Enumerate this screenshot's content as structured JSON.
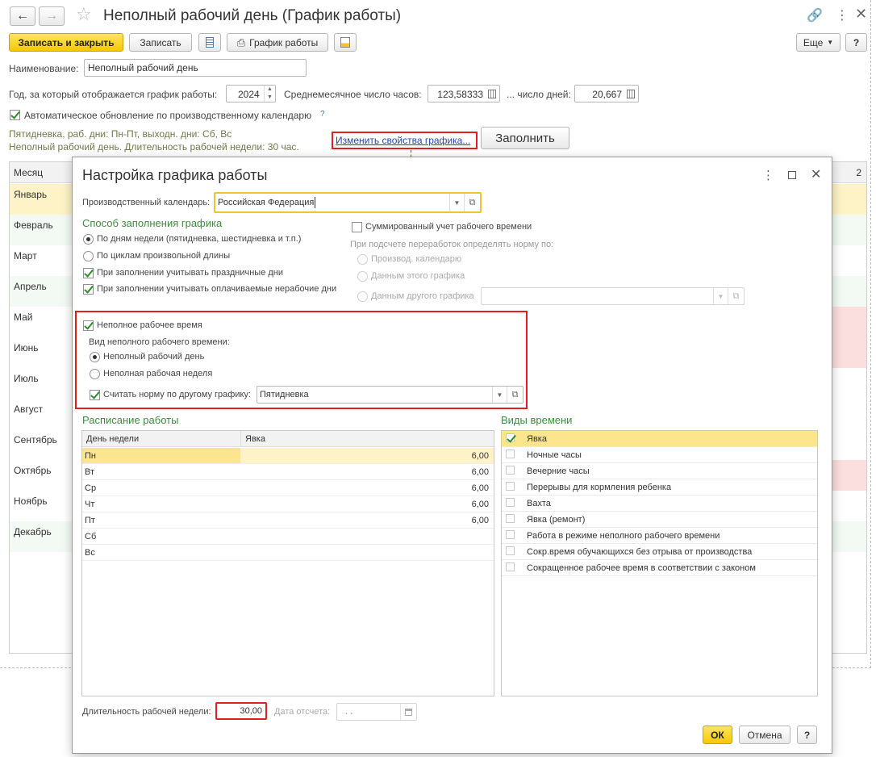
{
  "window": {
    "title": "Неполный рабочий день (График работы)"
  },
  "toolbar": {
    "save_close": "Записать и закрыть",
    "save": "Записать",
    "schedule_print": "График работы",
    "more": "Еще",
    "help": "?"
  },
  "form": {
    "name_label": "Наименование:",
    "name_value": "Неполный рабочий день",
    "year_label": "Год, за который отображается график работы:",
    "year_value": "2024",
    "avg_hours_label": "Среднемесячное число часов:",
    "avg_hours_value": "123,58333",
    "days_label": "... число дней:",
    "days_value": "20,667",
    "auto_update_label": "Автоматическое обновление по производственному календарю",
    "auto_update_help": "?",
    "info_line1": "Пятидневка, раб. дни: Пн-Пт, выходн. дни: Сб, Вс",
    "info_line2": "Неполный рабочий день. Длительность рабочей недели: 30 час.",
    "change_link": "Изменить свойства графика...",
    "fill_button": "Заполнить"
  },
  "calendar": {
    "month_header": "Месяц",
    "col_right": "2",
    "months": [
      "Январь",
      "Февраль",
      "Март",
      "Апрель",
      "Май",
      "Июнь",
      "Июль",
      "Август",
      "Сентябрь",
      "Октябрь",
      "Ноябрь",
      "Декабрь"
    ]
  },
  "dialog": {
    "title": "Настройка графика работы",
    "prod_calendar_label": "Производственный календарь:",
    "prod_calendar_value": "Российская Федерация",
    "fill_method_title": "Способ заполнения графика",
    "fill_by_weekdays": "По дням недели (пятидневка, шестидневка и т.п.)",
    "fill_by_cycles": "По циклам произвольной длины",
    "consider_holidays": "При заполнении учитывать праздничные дни",
    "consider_paid_nonwork": "При заполнении учитывать оплачиваемые нерабочие дни",
    "summed_accounting": "Суммированный учет рабочего времени",
    "overtime_norm_label": "При подсчете переработок определять норму по:",
    "norm_by_calendar": "Производ. календарю",
    "norm_by_this": "Данным этого графика",
    "norm_by_other": "Данным другого графика",
    "parttime_label": "Неполное рабочее время",
    "parttime_kind_label": "Вид неполного рабочего времени:",
    "parttime_day": "Неполный рабочий день",
    "parttime_week": "Неполная рабочая неделя",
    "norm_other_label": "Считать норму по другому графику:",
    "norm_other_value": "Пятидневка",
    "schedule_title": "Расписание работы",
    "schedule_col_day": "День недели",
    "schedule_col_attend": "Явка",
    "schedule_rows": [
      {
        "day": "Пн",
        "value": "6,00"
      },
      {
        "day": "Вт",
        "value": "6,00"
      },
      {
        "day": "Ср",
        "value": "6,00"
      },
      {
        "day": "Чт",
        "value": "6,00"
      },
      {
        "day": "Пт",
        "value": "6,00"
      },
      {
        "day": "Сб",
        "value": ""
      },
      {
        "day": "Вс",
        "value": ""
      }
    ],
    "time_types_title": "Виды времени",
    "time_types": [
      {
        "label": "Явка",
        "checked": true
      },
      {
        "label": "Ночные часы",
        "checked": false
      },
      {
        "label": "Вечерние часы",
        "checked": false
      },
      {
        "label": "Перерывы для кормления ребенка",
        "checked": false
      },
      {
        "label": "Вахта",
        "checked": false
      },
      {
        "label": "Явка (ремонт)",
        "checked": false
      },
      {
        "label": "Работа в режиме неполного рабочего времени",
        "checked": false
      },
      {
        "label": "Сокр.время обучающихся без отрыва от производства",
        "checked": false
      },
      {
        "label": "Сокращенное рабочее время в соответствии с законом",
        "checked": false
      }
    ],
    "week_length_label": "Длительность рабочей недели:",
    "week_length_value": "30,00",
    "ref_date_label": "Дата отсчета:",
    "ref_date_placeholder": ". .",
    "ok": "ОК",
    "cancel": "Отмена",
    "help": "?"
  },
  "colors": {
    "accent_yellow": "#f6c800",
    "highlight_red": "#e02020",
    "selection_yellow": "#fde58d",
    "group_green": "#3e8b3e"
  }
}
